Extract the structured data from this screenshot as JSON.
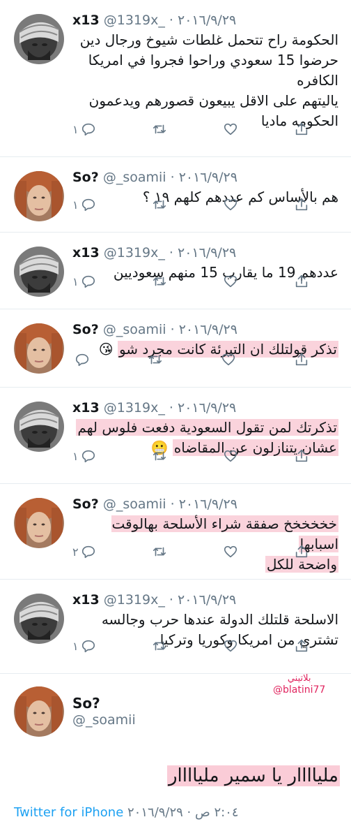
{
  "users": {
    "x13": {
      "name": "x13",
      "handle": "@1319x_"
    },
    "so": {
      "name": "So?",
      "handle": "@_soamii"
    }
  },
  "separator": "·",
  "tweets": [
    {
      "user": "x13",
      "date": "٢٠١٦/٩/٢٩",
      "lines": [
        "الحكومة راح تتحمل غلطات شيوخ ورجال دين",
        "حرضوا 15 سعودي وراحوا فجروا في امريكا",
        "الكافره",
        "ياليتهم على الاقل يبيعون قصورهم ويدعمون",
        "الحكومه ماديا"
      ],
      "reply_count": "١",
      "highlighted": false,
      "emoji": ""
    },
    {
      "user": "so",
      "date": "٢٠١٦/٩/٢٩",
      "lines": [
        "هم بالأساس كم عددهم كلهم ١٩ ؟"
      ],
      "reply_count": "١",
      "highlighted": false,
      "emoji": ""
    },
    {
      "user": "x13",
      "date": "٢٠١٦/٩/٢٩",
      "lines": [
        "عددهم 19 ما يقارب 15 منهم سعوديين"
      ],
      "reply_count": "١",
      "highlighted": false,
      "emoji": ""
    },
    {
      "user": "so",
      "date": "٢٠١٦/٩/٢٩",
      "lines": [
        "تذكر قولتلك ان التبرئة كانت مجرد شو"
      ],
      "reply_count": "",
      "highlighted": true,
      "emoji": "😘"
    },
    {
      "user": "x13",
      "date": "٢٠١٦/٩/٢٩",
      "lines": [
        "تذكرتك لمن تقول السعودية دفعت فلوس لهم",
        "عشان يتنازلون عن المقاضاه"
      ],
      "reply_count": "١",
      "highlighted": true,
      "emoji": "😬"
    },
    {
      "user": "so",
      "date": "٢٠١٦/٩/٢٩",
      "lines": [
        "خخخخخخ صفقة شراء الأسلحة بهالوقت اسبابها",
        "واضحة للكل"
      ],
      "reply_count": "٢",
      "highlighted": true,
      "emoji": ""
    },
    {
      "user": "x13",
      "date": "٢٠١٦/٩/٢٩",
      "lines": [
        "الاسلحة قلتلك الدولة عندها حرب وجالسه",
        "تشتري من امريكا وكوريا وتركيا"
      ],
      "reply_count": "١",
      "highlighted": false,
      "emoji": ""
    }
  ],
  "watermark": {
    "arabic": "بلاتيني",
    "handle": "@blatini77"
  },
  "final_tweet": {
    "name": "So?",
    "handle": "@_soamii",
    "text": "ملياااار يا سمير ملياااار",
    "client": "Twitter for iPhone",
    "meta": "٢:٠٤ ص · ٢٠١٦/٩/٢٩"
  },
  "icons": {
    "reply": "reply-icon",
    "retweet": "retweet-icon",
    "like": "like-icon",
    "share": "share-icon"
  },
  "colors": {
    "link": "#1da1f2",
    "secondary": "#657786",
    "highlight": "#f06e8c",
    "watermark": "#e0245e"
  }
}
